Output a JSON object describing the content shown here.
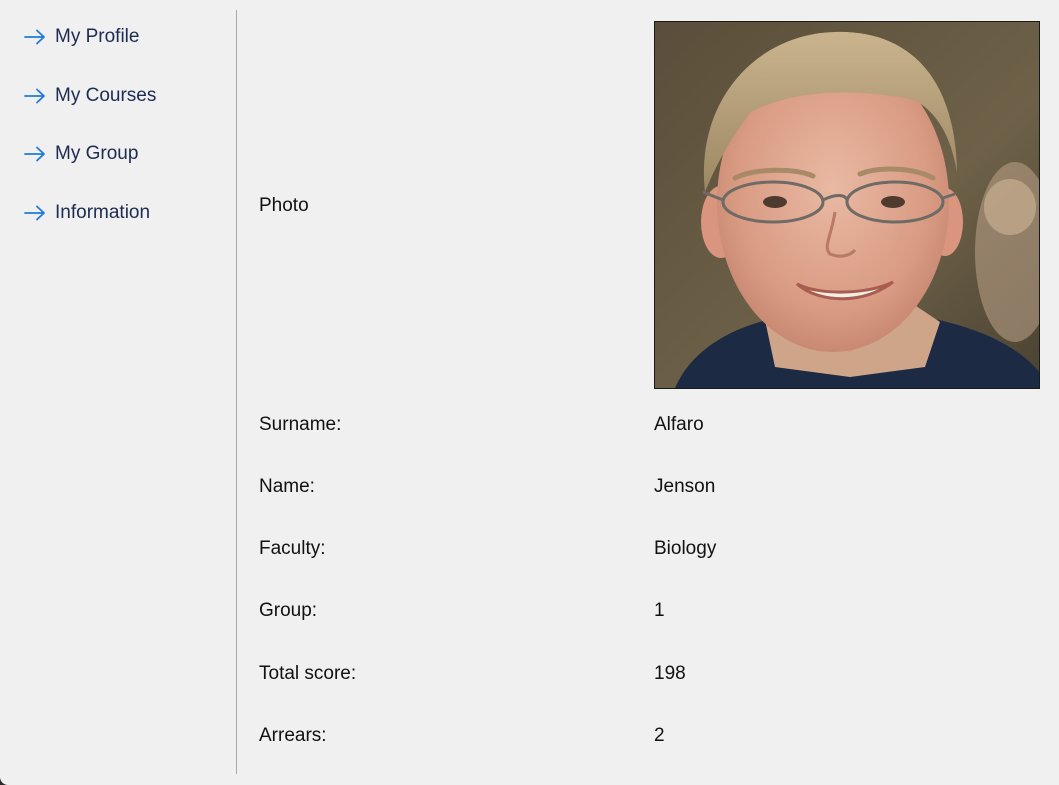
{
  "sidebar": {
    "items": [
      {
        "label": "My Profile",
        "icon": "arrow-right-icon"
      },
      {
        "label": "My Courses",
        "icon": "arrow-right-icon"
      },
      {
        "label": "My Group",
        "icon": "arrow-right-icon"
      },
      {
        "label": "Information",
        "icon": "arrow-right-icon"
      }
    ],
    "accent_color": "#1e7bd6"
  },
  "profile": {
    "photo_label": "Photo",
    "fields": [
      {
        "label": "Surname:",
        "value": "Alfaro"
      },
      {
        "label": "Name:",
        "value": "Jenson"
      },
      {
        "label": "Faculty:",
        "value": "Biology"
      },
      {
        "label": "Group:",
        "value": "1"
      },
      {
        "label": "Total score:",
        "value": "198"
      },
      {
        "label": "Arrears:",
        "value": "2"
      }
    ]
  }
}
